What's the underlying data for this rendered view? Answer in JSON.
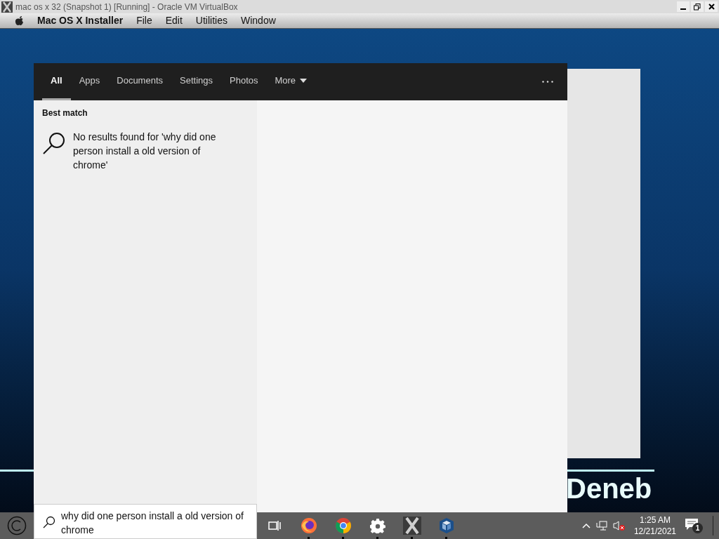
{
  "window": {
    "title": "mac os x 32 (Snapshot 1) [Running] - Oracle VM VirtualBox"
  },
  "menubar": {
    "app_name": "Mac OS X Installer",
    "items": [
      "File",
      "Edit",
      "Utilities",
      "Window"
    ]
  },
  "desktop": {
    "label": "Deneb"
  },
  "search": {
    "tabs": [
      {
        "label": "All",
        "selected": true
      },
      {
        "label": "Apps",
        "selected": false
      },
      {
        "label": "Documents",
        "selected": false
      },
      {
        "label": "Settings",
        "selected": false
      },
      {
        "label": "Photos",
        "selected": false
      },
      {
        "label": "More",
        "selected": false
      }
    ],
    "section_heading": "Best match",
    "no_results": "No results found for 'why did one person install a old version of chrome'",
    "query": "why did one person install a old version of chrome"
  },
  "taskbar": {
    "apps": [
      {
        "kind": "taskview",
        "running": false
      },
      {
        "kind": "firefox",
        "running": true
      },
      {
        "kind": "chrome",
        "running": true
      },
      {
        "kind": "gear",
        "running": true
      },
      {
        "kind": "x",
        "running": true
      },
      {
        "kind": "cube",
        "running": true
      }
    ],
    "time": "1:25 AM",
    "date": "12/21/2021",
    "notifications": "1"
  }
}
